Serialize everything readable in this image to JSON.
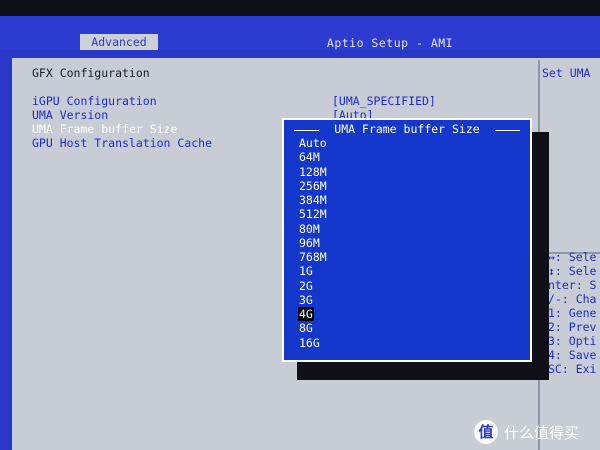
{
  "header": {
    "title": "Aptio Setup - AMI",
    "active_tab": "Advanced"
  },
  "main": {
    "section_title": "GFX Configuration",
    "items": [
      {
        "label": "iGPU Configuration",
        "value": "[UMA_SPECIFIED]"
      },
      {
        "label": "UMA Version",
        "value": "[Auto]"
      },
      {
        "label": "UMA Frame buffer Size",
        "value": ""
      },
      {
        "label": "GPU Host Translation Cache",
        "value": ""
      }
    ]
  },
  "help_panel": {
    "title": "Set UMA",
    "hints": [
      "↔: Sele",
      "↕: Sele",
      "nter: S",
      "/-: Cha",
      "1: Gene",
      "2: Prev",
      "3: Opti",
      "4: Save",
      "SC: Exi"
    ]
  },
  "popup": {
    "title": "UMA Frame buffer Size",
    "options": [
      "Auto",
      "64M",
      "128M",
      "256M",
      "384M",
      "512M",
      "80M",
      "96M",
      "768M",
      "1G",
      "2G",
      "3G",
      "4G",
      "8G",
      "16G"
    ],
    "selected": "4G"
  },
  "watermark": {
    "icon_glyph": "值",
    "text": "什么值得买"
  },
  "colors": {
    "bios_blue": "#2838c8",
    "frame_gray": "#c8ccd4",
    "popup_blue": "#1538cc"
  }
}
